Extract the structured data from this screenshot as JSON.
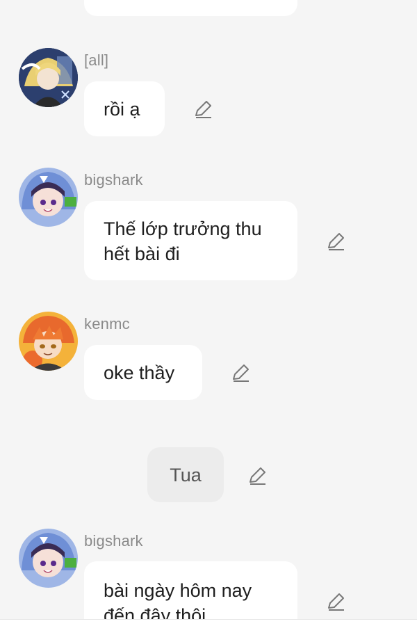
{
  "messages": [
    {
      "sender": "[all]",
      "text": "rồi ạ"
    },
    {
      "sender": "bigshark",
      "text_lines": [
        "Thế lớp trưởng thu",
        "hết bài đi"
      ]
    },
    {
      "sender": "kenmc",
      "text": "oke thầy"
    },
    {
      "sender": "",
      "text": "Tua"
    },
    {
      "sender": "bigshark",
      "text_lines": [
        "bài ngày hôm nay",
        "đến đây thôi"
      ]
    }
  ],
  "icons": {
    "edit": "edit-pencil-icon",
    "avatar_all": "avatar-blonde-character",
    "avatar_bigshark": "avatar-shark-hood-character",
    "avatar_kenmc": "avatar-orange-hair-character"
  },
  "colors": {
    "background": "#f5f5f5",
    "bubble": "#ffffff",
    "centered_bubble": "#ececec",
    "sender_text": "#8a8a8a",
    "message_text": "#1e1e1e"
  }
}
